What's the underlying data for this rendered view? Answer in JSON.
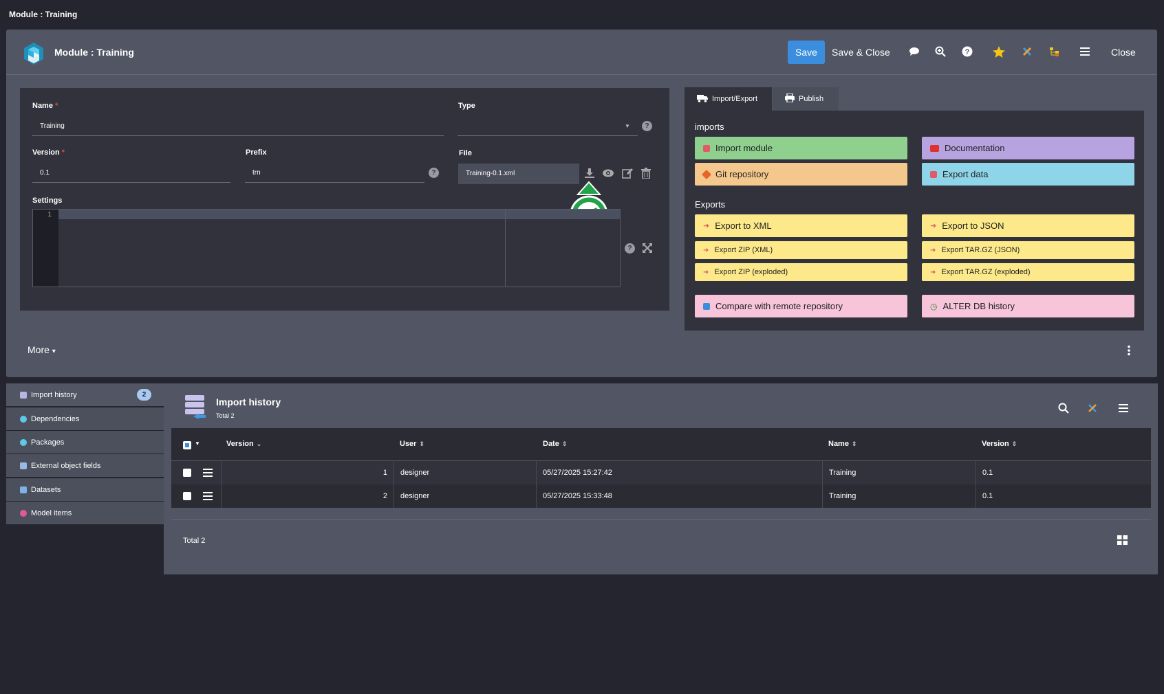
{
  "window": {
    "title": "Module : Training"
  },
  "header": {
    "title": "Module : Training",
    "save_label": "Save",
    "save_close_label": "Save & Close",
    "close_label": "Close",
    "icons": [
      "comment-icon",
      "search-icon",
      "help-icon",
      "star-icon",
      "tools-icon",
      "tree-icon",
      "menu-icon"
    ]
  },
  "form": {
    "name_label": "Name",
    "name_value": "Training",
    "type_label": "Type",
    "type_value": "",
    "version_label": "Version",
    "version_value": "0.1",
    "prefix_label": "Prefix",
    "prefix_value": "trn",
    "file_label": "File",
    "file_value": "Training-0.1.xml",
    "settings_label": "Settings",
    "editor_line": "1",
    "required_mark": "*"
  },
  "tabs": [
    {
      "label": "Import/Export",
      "active": true
    },
    {
      "label": "Publish",
      "active": false
    }
  ],
  "imports": {
    "heading": "imports",
    "buttons": [
      {
        "label": "Import module",
        "color": "#8fd08e"
      },
      {
        "label": "Documentation",
        "color": "#b7a3e0"
      },
      {
        "label": "Git repository",
        "color": "#f4c88c"
      },
      {
        "label": "Export data",
        "color": "#8fd5ea"
      }
    ]
  },
  "exports": {
    "heading": "Exports",
    "buttons": [
      {
        "label": "Export to XML"
      },
      {
        "label": "Export to JSON"
      },
      {
        "label": "Export ZIP (XML)"
      },
      {
        "label": "Export TAR.GZ (JSON)"
      },
      {
        "label": "Export ZIP (exploded)"
      },
      {
        "label": "Export TAR.GZ (exploded)"
      },
      {
        "label": "Compare with remote repository"
      },
      {
        "label": "ALTER DB history"
      }
    ]
  },
  "more_label": "More",
  "sidebar": {
    "items": [
      {
        "label": "Import history",
        "badge": "2",
        "icon": "stack-icon"
      },
      {
        "label": "Dependencies",
        "icon": "cubes-icon"
      },
      {
        "label": "Packages",
        "icon": "cubes-icon"
      },
      {
        "label": "External object fields",
        "icon": "file-icon"
      },
      {
        "label": "Datasets",
        "icon": "document-icon"
      },
      {
        "label": "Model items",
        "icon": "share-icon"
      }
    ]
  },
  "grid": {
    "title": "Import history",
    "subtitle": "Total 2",
    "columns": [
      "Version",
      "User",
      "Date",
      "Name",
      "Version"
    ],
    "rows": [
      {
        "num": "1",
        "user": "designer",
        "date": "05/27/2025 15:27:42",
        "name": "Training",
        "version": "0.1"
      },
      {
        "num": "2",
        "user": "designer",
        "date": "05/27/2025 15:33:48",
        "name": "Training",
        "version": "0.1"
      }
    ],
    "footer_total": "Total 2"
  },
  "colors": {
    "accent": "#3b8ede",
    "background": "#25252f",
    "panel": "#525563",
    "success": "#22a34a"
  }
}
